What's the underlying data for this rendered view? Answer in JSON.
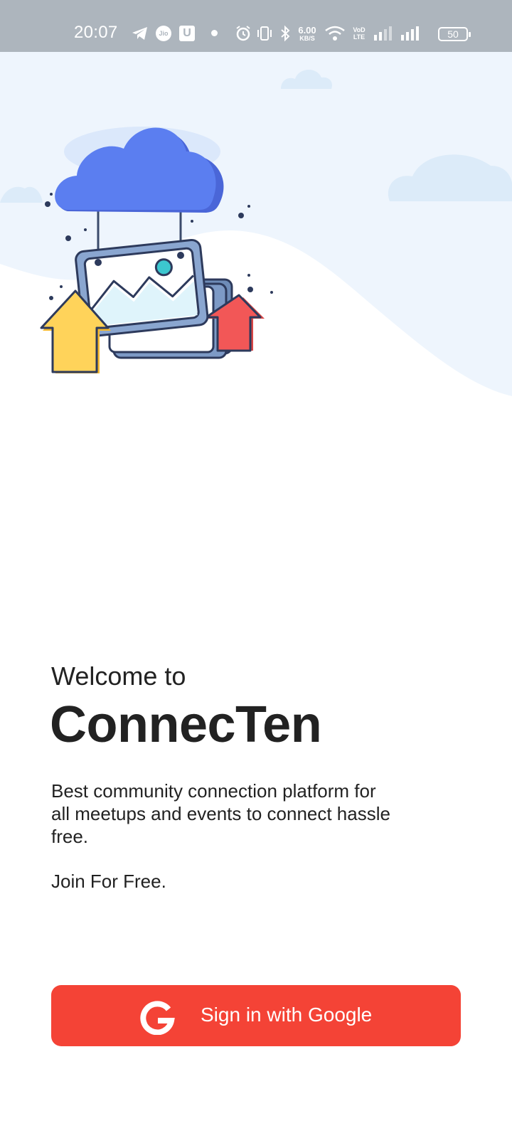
{
  "status_bar": {
    "time": "20:07",
    "carrier_icon_text": "Jio",
    "app_icon_letter": "U",
    "network_speed_value": "6.00",
    "network_speed_unit": "KB/S",
    "volte_top": "VoD",
    "volte_bottom": "LTE",
    "battery_level": "50",
    "icons": [
      "telegram-icon",
      "jio-icon",
      "app-u-icon",
      "dot-icon",
      "alarm-icon",
      "vibrate-icon",
      "bluetooth-icon",
      "wifi-icon",
      "volte-icon",
      "signal-icon",
      "signal-icon",
      "battery-icon"
    ]
  },
  "hero": {
    "illustration": "cloud-upload-photos-illustration",
    "colors": {
      "background": "#eef5fd",
      "cloud": "#5b7ef0",
      "arrow_yellow": "#ffd35a",
      "arrow_red": "#f25757"
    }
  },
  "main": {
    "welcome_text": "Welcome to",
    "app_name": "ConnecTen",
    "description": "Best community connection platform for all meetups and events to connect hassle free.",
    "join_text": "Join For Free."
  },
  "signin": {
    "label": "Sign in with Google",
    "icon": "google-g-icon",
    "color": "#f44336"
  }
}
